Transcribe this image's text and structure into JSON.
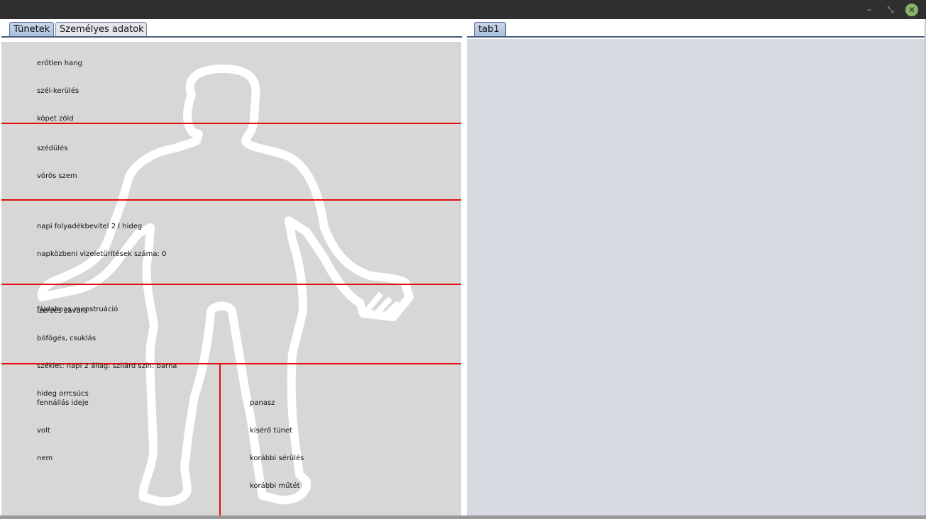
{
  "window": {
    "minimize_icon": "minimize-icon",
    "restore_icon": "restore-icon",
    "close_icon": "close-icon",
    "minimize_glyph": "‒",
    "restore_glyph": "⤡",
    "close_glyph": "✕"
  },
  "left_tabs": [
    {
      "label": "Tünetek",
      "active": true
    },
    {
      "label": "Személyes adatok",
      "active": false
    }
  ],
  "right_tabs": [
    {
      "label": "tab1",
      "active": true
    }
  ],
  "zones": {
    "head": [
      "erőtlen hang",
      "szél-kerülés",
      "köpet zöld"
    ],
    "chest": [
      "szédülés",
      "vörös szem"
    ],
    "abdomen": [
      "napi folyadékbevitel 2 l hideg",
      "napközbeni vizeletürítések száma: 0",
      "",
      "fájdalmas menstruáció"
    ],
    "lower": [
      "ízérzés zavara",
      "böfögés, csuklás",
      "széklet: napi 2 állag: szilárd szín: barna",
      "hideg orrcsúcs"
    ],
    "bottom_left": [
      "fennállás ideje",
      "volt",
      "nem"
    ],
    "bottom_right": [
      "panasz",
      "kísérő tünet",
      "korábbi sérülés",
      "korábbi műtét"
    ]
  },
  "colors": {
    "zone_line": "#e01010",
    "panel_bg": "#d9d7d5",
    "right_panel_bg": "#d6d9e0",
    "silhouette": "#ffffff"
  }
}
